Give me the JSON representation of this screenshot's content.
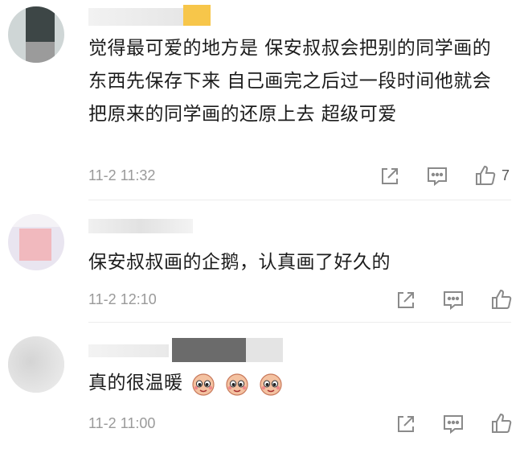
{
  "comments": [
    {
      "text": "觉得最可爱的地方是 保安叔叔会把别的同学画的东西先保存下来 自己画完之后过一段时间他就会把原来的同学画的还原上去 超级可爱",
      "time": "11-2 11:32",
      "likes": "7",
      "icons": [
        "share-icon",
        "comment-icon",
        "like-icon"
      ]
    },
    {
      "text": "保安叔叔画的企鹅，认真画了好久的",
      "time": "11-2 12:10",
      "icons": [
        "share-icon",
        "comment-icon",
        "like-icon"
      ]
    },
    {
      "text": "真的很温暖",
      "time": "11-2 11:00",
      "emoji_count": 3,
      "icons": [
        "share-icon",
        "comment-icon",
        "like-icon"
      ]
    }
  ],
  "colors": {
    "time_gray": "#9a9a9a",
    "icon_gray": "#8a8a8a",
    "name_highlight": "#f7c64a"
  }
}
